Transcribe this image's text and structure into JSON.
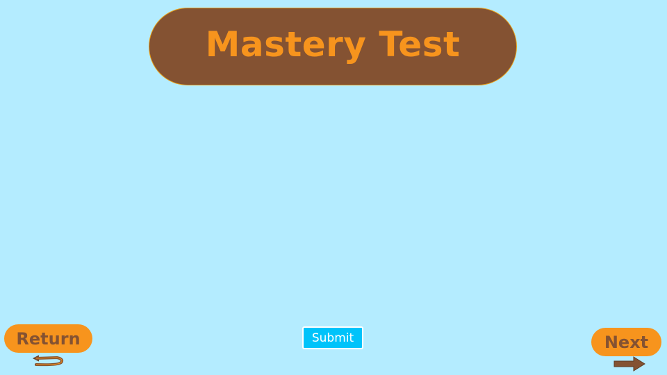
{
  "header": {
    "title": "Mastery Test"
  },
  "navigation": {
    "return_label": "Return",
    "return_icon": "return-arrow-icon",
    "next_label": "Next",
    "next_icon": "right-arrow-icon"
  },
  "actions": {
    "submit_label": "Submit"
  },
  "colors": {
    "background": "#b4ecff",
    "title_pill": "#845232",
    "accent_orange": "#f7941d",
    "submit_blue": "#00c3fa"
  }
}
